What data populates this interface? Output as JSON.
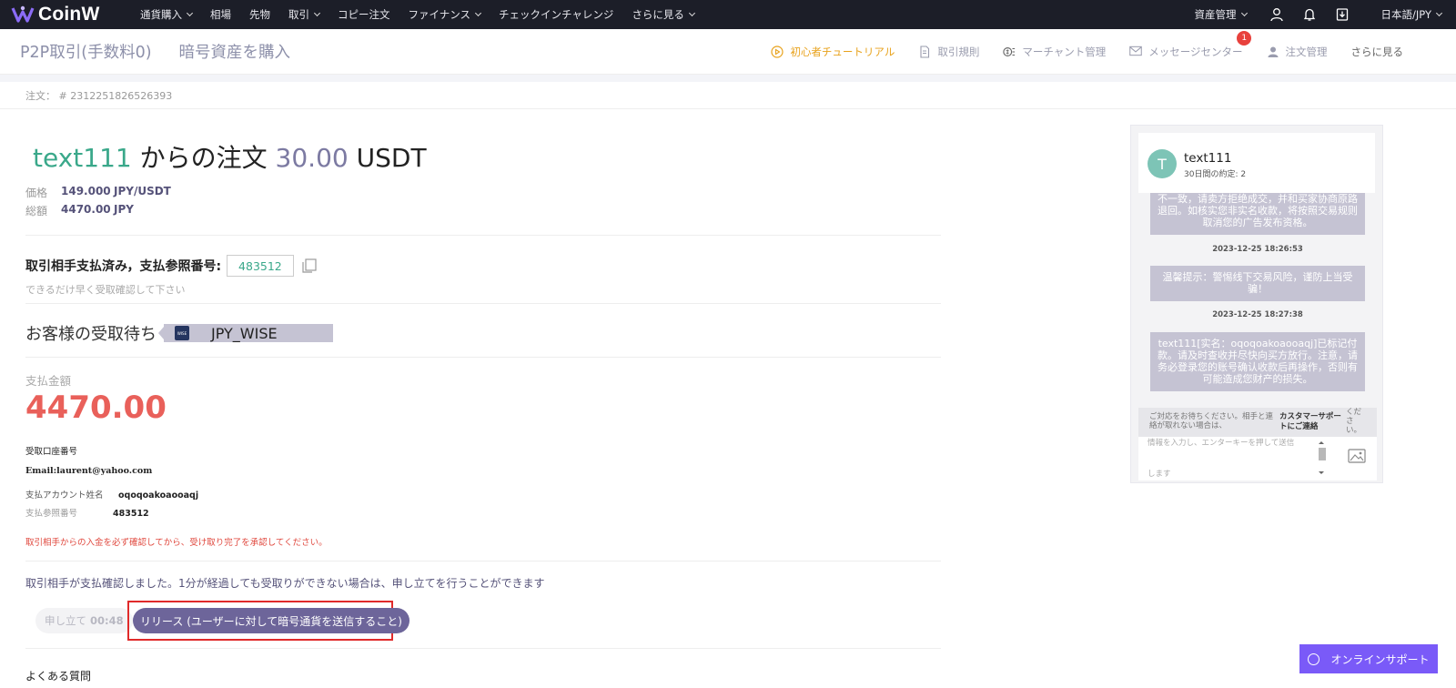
{
  "nav": {
    "brand": "CoinW",
    "items": [
      {
        "label": "通貨購入",
        "dropdown": true
      },
      {
        "label": "相場",
        "dropdown": false
      },
      {
        "label": "先物",
        "dropdown": false
      },
      {
        "label": "取引",
        "dropdown": true
      },
      {
        "label": "コピー注文",
        "dropdown": false
      },
      {
        "label": "ファイナンス",
        "dropdown": true
      },
      {
        "label": "チェックインチャレンジ",
        "dropdown": false
      },
      {
        "label": "さらに見る",
        "dropdown": true
      }
    ],
    "asset_label": "資産管理",
    "lang_label": "日本語/JPY",
    "icons": [
      "user-icon",
      "bell-icon",
      "download-icon"
    ]
  },
  "subhead": {
    "tabs": [
      "P2P取引(手数料0)",
      "暗号資産を購入"
    ],
    "links": {
      "tutorial": "初心者チュートリアル",
      "rules": "取引規則",
      "merchant": "マーチャント管理",
      "messages": "メッセージセンター",
      "messages_badge": "1",
      "orders": "注文管理",
      "more": "さらに見る"
    }
  },
  "order": {
    "number_label": "注文： # 2312251826526393",
    "title_user": "text111",
    "title_from": "からの注文",
    "title_amount": "30.00",
    "title_unit": "USDT",
    "price_label": "価格",
    "price_value": "149.000",
    "price_unit": "JPY/USDT",
    "total_label": "総額",
    "total_value": "4470.00",
    "total_unit": "JPY",
    "paid_label": "取引相手支払済み，支払参照番号:",
    "ref_number": "483512",
    "paid_hint": "できるだけ早く受取確認して下さい",
    "waiting_label": "お客様の受取待ち",
    "method_logo": "WISE",
    "method_name": "JPY_WISE",
    "pay_amount_label": "支払金額",
    "pay_amount": "4470.00",
    "account_label": "受取口座番号",
    "account_value": "Email:laurent@yahoo.com",
    "holder_label": "支払アカウント姓名",
    "holder_value": "oqoqoakoaooaqj",
    "ref_label": "支払参照番号",
    "ref_value": "483512",
    "warning": "取引相手からの入金を必ず確認してから、受け取り完了を承認してください。",
    "note": "取引相手が支払確認しました。1分が経過しても受取りができない場合は、申し立てを行うことができます",
    "appeal_label": "申し立て",
    "appeal_timer": "00:48",
    "release_label": "リリース (ユーザーに対して暗号通貨を送信すること)",
    "faq_label": "よくある質問"
  },
  "chat": {
    "avatar_letter": "T",
    "name": "text111",
    "sub": "30日間の約定: 2",
    "bubble1": "不一致，请卖方拒绝成交，并和买家协商原路退回。如核实您非实名收款，将按照交易规则取消您的广告发布资格。",
    "ts1": "2023-12-25 18:26:53",
    "bubble2": "温馨提示：警惕线下交易风险，谨防上当受骗！",
    "ts2": "2023-12-25 18:27:38",
    "bubble3": "text111[实名：oqoqoakoaooaqj]已标记付款。请及时查收并尽快向买方放行。注意，请务必登录您的账号确认收款后再操作，否则有可能造成您财产的损失。",
    "contact_1": "ご対応をお待ちください。相手と連絡が取れない場合は、",
    "contact_2": "カスタマーサポートにご連絡",
    "contact_3": "ください。",
    "input_placeholder": "情報を入力し、エンターキーを押して送信",
    "input_placeholder2": "します"
  },
  "support": {
    "label": "オンラインサポート"
  },
  "colors": {
    "nav_bg": "#1c1e28",
    "accent_green": "#3aa88a",
    "accent_purple": "#6d659a",
    "danger": "#e9605a",
    "tutorial": "#e8a21c",
    "support_bg": "#7a5af8"
  }
}
